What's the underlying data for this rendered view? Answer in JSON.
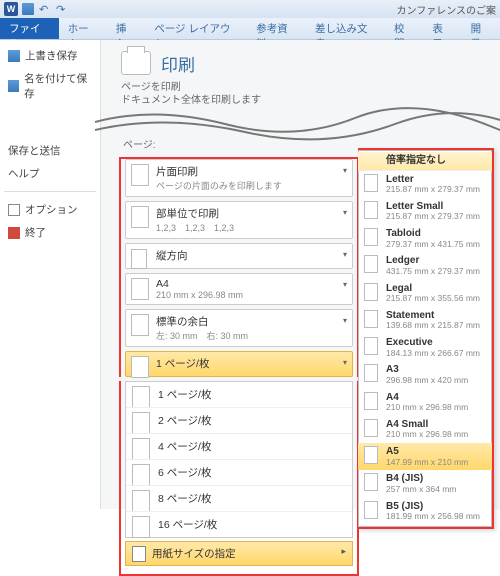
{
  "doc_title": "カンファレンスのご案",
  "tabs": {
    "file": "ファイル",
    "home": "ホーム",
    "insert": "挿入",
    "layout": "ページ レイアウト",
    "ref": "参考資料",
    "mail": "差し込み文書",
    "review": "校閲",
    "view": "表示",
    "dev": "開発"
  },
  "sidebar": {
    "save": "上書き保存",
    "saveas": "名を付けて保存",
    "saveandsend": "保存と送信",
    "help": "ヘルプ",
    "options": "オプション",
    "exit": "終了"
  },
  "print": {
    "title": "印刷",
    "sub1": "ページを印刷",
    "sub2": "ドキュメント全体を印刷します",
    "page_label": "ページ:"
  },
  "settings": {
    "side": {
      "t": "片面印刷",
      "s": "ページの片面のみを印刷します"
    },
    "collate": {
      "t": "部単位で印刷",
      "s": "1,2,3　1,2,3　1,2,3"
    },
    "orient": {
      "t": "縦方向"
    },
    "paper": {
      "t": "A4",
      "s": "210 mm x 296.98 mm"
    },
    "margin": {
      "t": "標準の余白",
      "s": "左: 30 mm　右: 30 mm"
    },
    "ppp": {
      "t": "1 ページ/枚"
    },
    "ppp_opts": [
      "1 ページ/枚",
      "2 ページ/枚",
      "4 ページ/枚",
      "6 ページ/枚",
      "8 ページ/枚",
      "16 ページ/枚"
    ],
    "size_spec": "用紙サイズの指定"
  },
  "flyout": {
    "none": "倍率指定なし",
    "items": [
      {
        "t": "Letter",
        "s": "215.87 mm x 279.37 mm"
      },
      {
        "t": "Letter Small",
        "s": "215.87 mm x 279.37 mm"
      },
      {
        "t": "Tabloid",
        "s": "279.37 mm x 431.75 mm"
      },
      {
        "t": "Ledger",
        "s": "431.75 mm x 279.37 mm"
      },
      {
        "t": "Legal",
        "s": "215.87 mm x 355.56 mm"
      },
      {
        "t": "Statement",
        "s": "139.68 mm x 215.87 mm"
      },
      {
        "t": "Executive",
        "s": "184.13 mm x 266.67 mm"
      },
      {
        "t": "A3",
        "s": "296.98 mm x 420 mm"
      },
      {
        "t": "A4",
        "s": "210 mm x 296.98 mm"
      },
      {
        "t": "A4 Small",
        "s": "210 mm x 296.98 mm"
      },
      {
        "t": "A5",
        "s": "147.99 mm x 210 mm",
        "sel": true
      },
      {
        "t": "B4 (JIS)",
        "s": "257 mm x 364 mm"
      },
      {
        "t": "B5 (JIS)",
        "s": "181.99 mm x 256.98 mm"
      }
    ]
  }
}
